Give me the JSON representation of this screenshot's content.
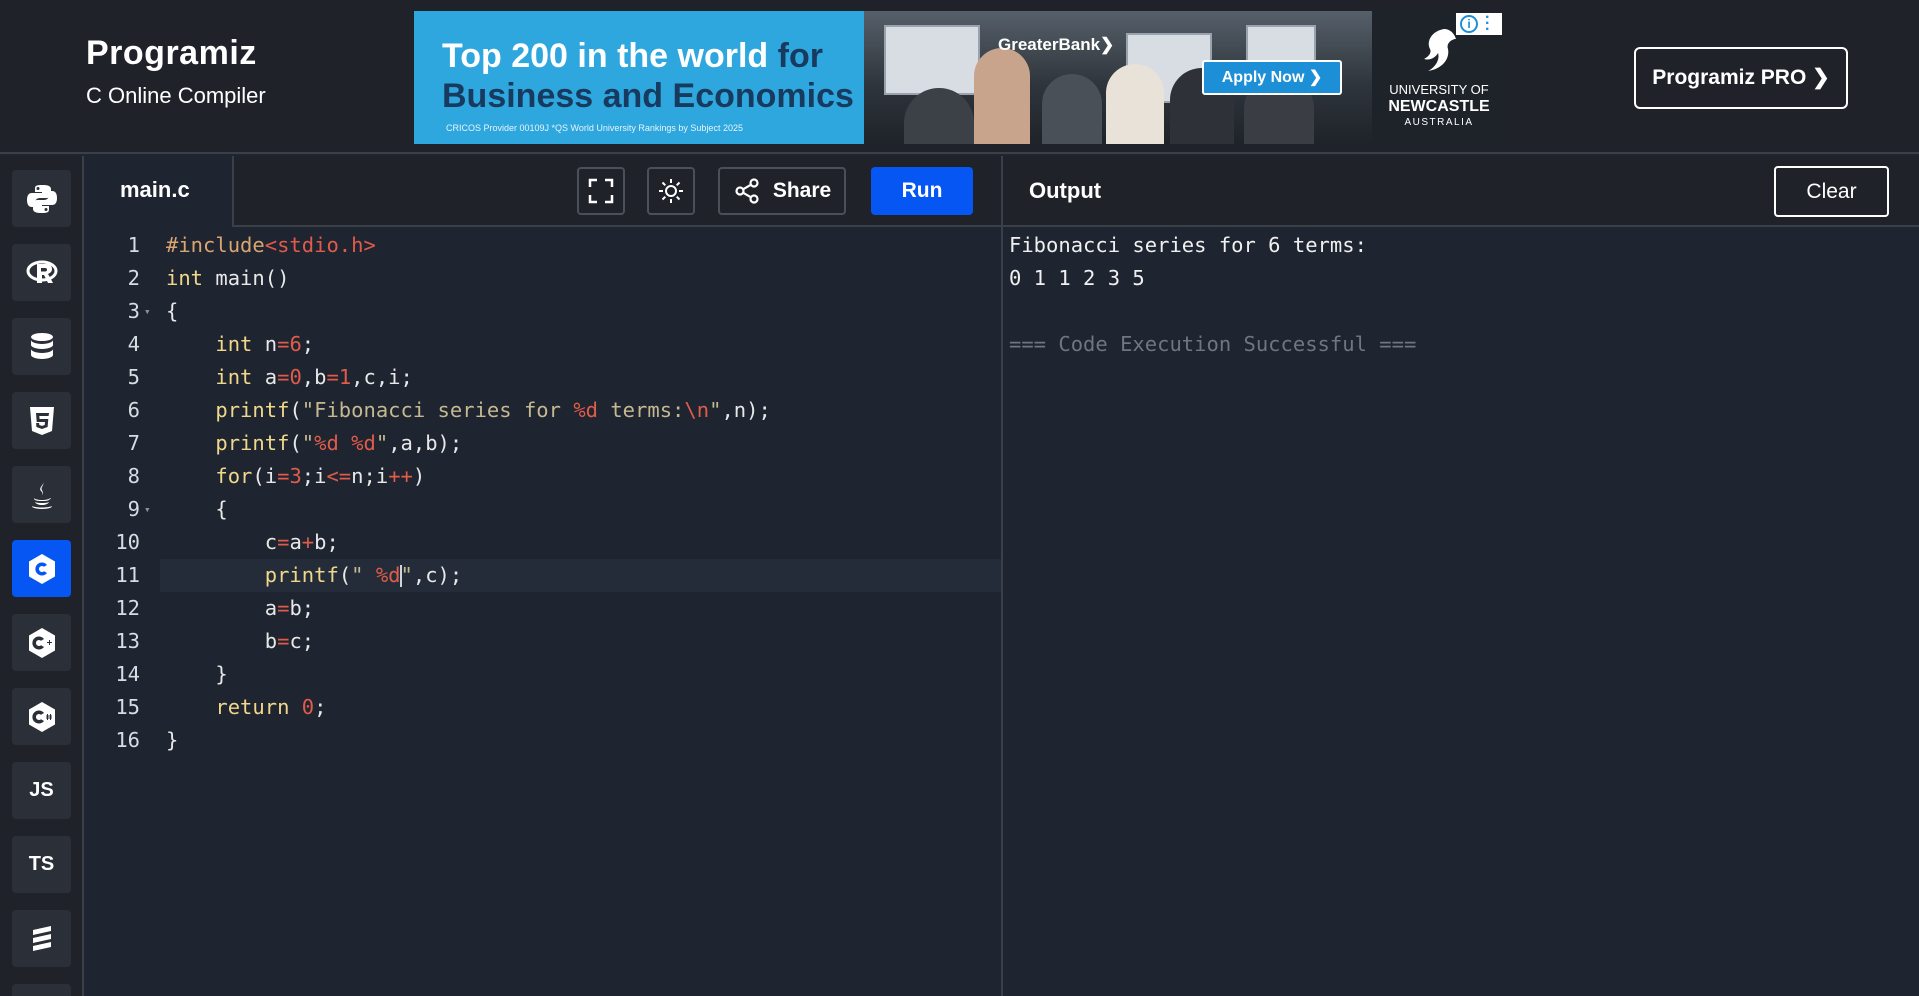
{
  "header": {
    "logo_name": "Programiz",
    "logo_subtitle": "C Online Compiler",
    "pro_button": "Programiz PRO ❯"
  },
  "ad": {
    "headline_part1": "Top 200 in the world ",
    "headline_part1b": "for",
    "headline_part2": "Business and Economics",
    "fine_print": "CRICOS Provider 00109J      *QS World University Rankings by Subject 2025",
    "bank_name": "GreaterBank❯",
    "apply_button": "Apply Now ❯",
    "uni_line1": "UNIVERSITY OF",
    "uni_line2": "NEWCASTLE",
    "uni_line3": "AUSTRALIA"
  },
  "rail": {
    "items": [
      {
        "name": "python-icon",
        "label": ""
      },
      {
        "name": "r-icon",
        "label": ""
      },
      {
        "name": "sql-icon",
        "label": ""
      },
      {
        "name": "html5-icon",
        "label": ""
      },
      {
        "name": "java-icon",
        "label": ""
      },
      {
        "name": "c-icon",
        "label": "",
        "active": true
      },
      {
        "name": "cpp-icon",
        "label": ""
      },
      {
        "name": "csharp-icon",
        "label": ""
      },
      {
        "name": "js-icon",
        "label": "JS"
      },
      {
        "name": "ts-icon",
        "label": "TS"
      },
      {
        "name": "swift-icon",
        "label": ""
      }
    ]
  },
  "editor": {
    "file_name": "main.c",
    "share_label": "Share",
    "run_label": "Run",
    "active_line": 11,
    "lines": [
      "#include<stdio.h>",
      "int main()",
      "{",
      "    int n=6;",
      "    int a=0,b=1,c,i;",
      "    printf(\"Fibonacci series for %d terms:\\n\",n);",
      "    printf(\"%d %d\",a,b);",
      "    for(i=3;i<=n;i++)",
      "    {",
      "        c=a+b;",
      "        printf(\" %d\",c);",
      "        a=b;",
      "        b=c;",
      "    }",
      "    return 0;",
      "}"
    ],
    "folds": [
      3,
      9
    ]
  },
  "output": {
    "title": "Output",
    "clear_label": "Clear",
    "lines": [
      {
        "text": "Fibonacci series for 6 terms:",
        "muted": false
      },
      {
        "text": "0 1 1 2 3 5",
        "muted": false
      },
      {
        "text": "",
        "muted": false
      },
      {
        "text": "=== Code Execution Successful ===",
        "muted": true
      }
    ]
  }
}
